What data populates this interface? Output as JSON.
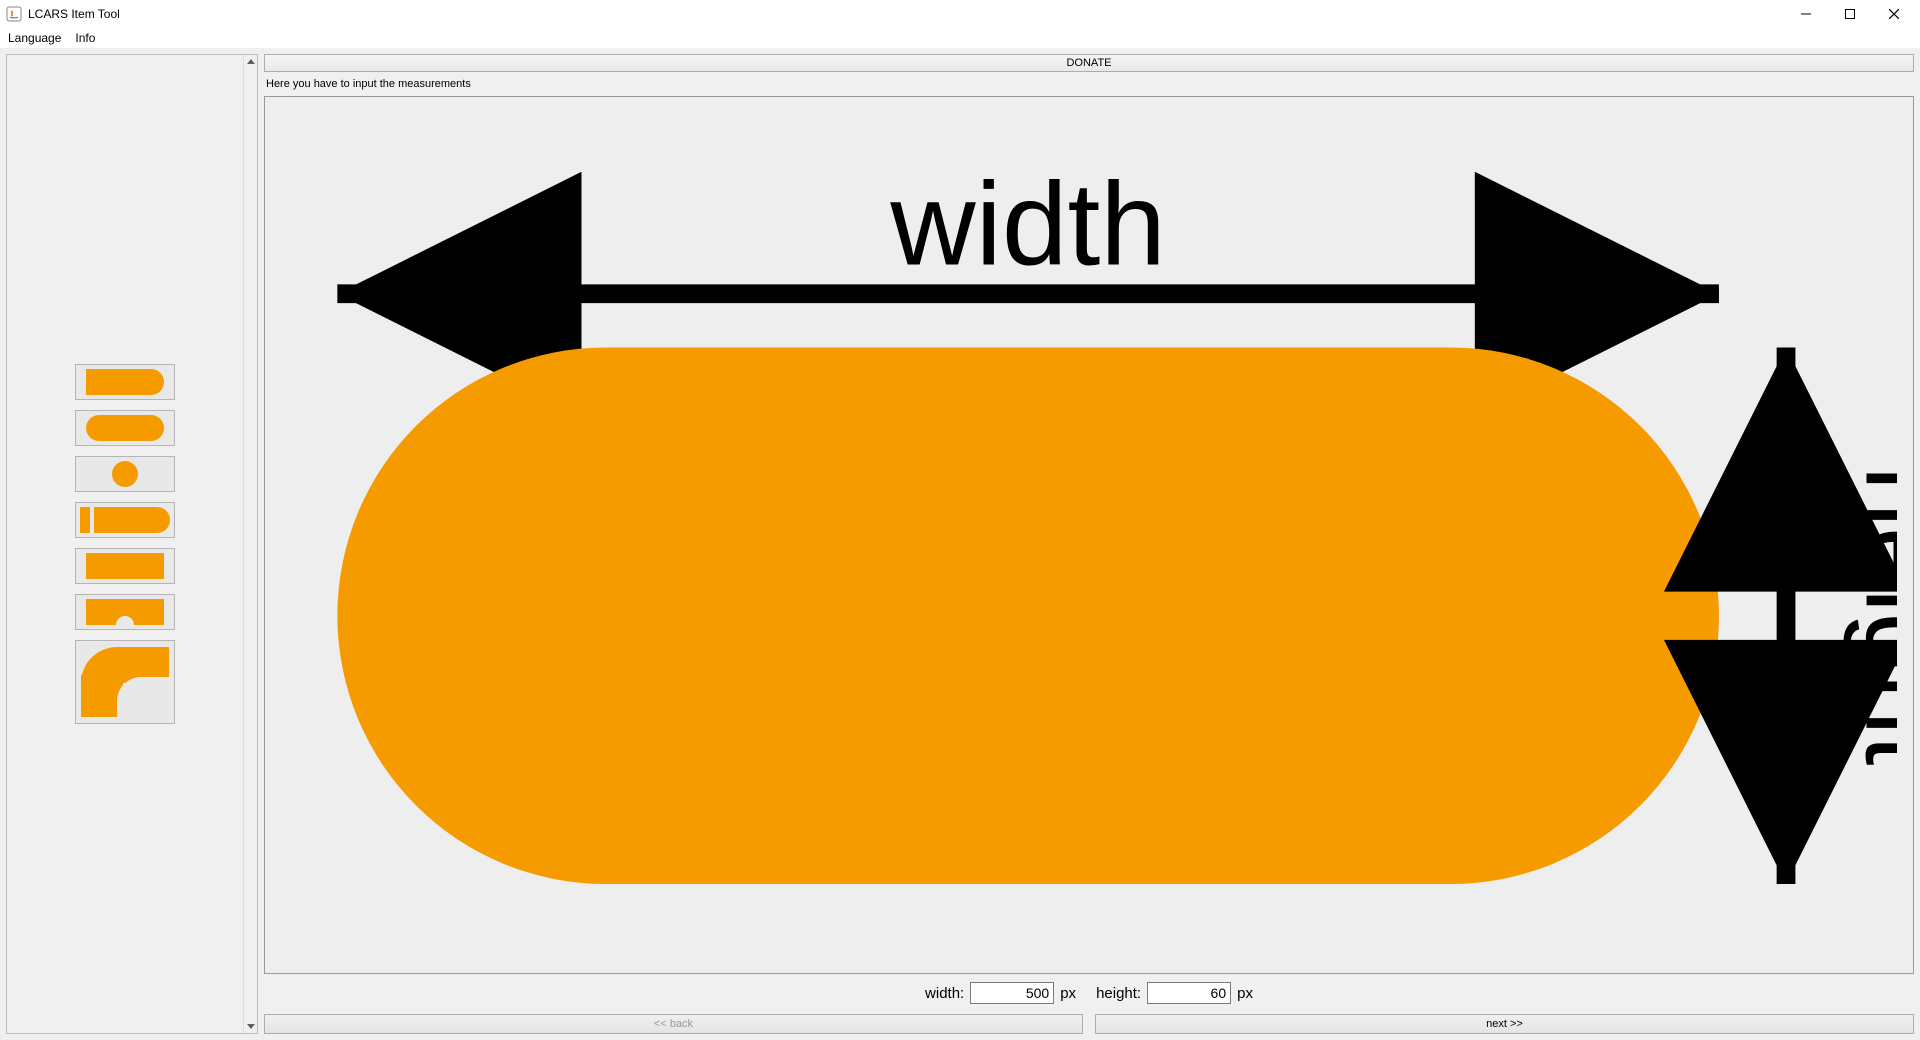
{
  "window": {
    "title": "LCARS Item Tool"
  },
  "menubar": {
    "language": "Language",
    "info": "Info"
  },
  "sidebar": {
    "shapes": [
      {
        "name": "half-pill"
      },
      {
        "name": "pill"
      },
      {
        "name": "circle"
      },
      {
        "name": "endcap"
      },
      {
        "name": "rectangle"
      },
      {
        "name": "notch-rectangle"
      },
      {
        "name": "elbow"
      }
    ]
  },
  "main": {
    "donate_label": "DONATE",
    "instructions": "Here you have to input the measurements",
    "diagram": {
      "width_label": "width",
      "height_label": "height"
    },
    "inputs": {
      "width_label": "width:",
      "width_value": "500",
      "width_unit": "px",
      "height_label": "height:",
      "height_value": "60",
      "height_unit": "px"
    },
    "nav": {
      "back_label": "<< back",
      "next_label": "next >>"
    }
  },
  "colors": {
    "accent": "#f59b00"
  }
}
